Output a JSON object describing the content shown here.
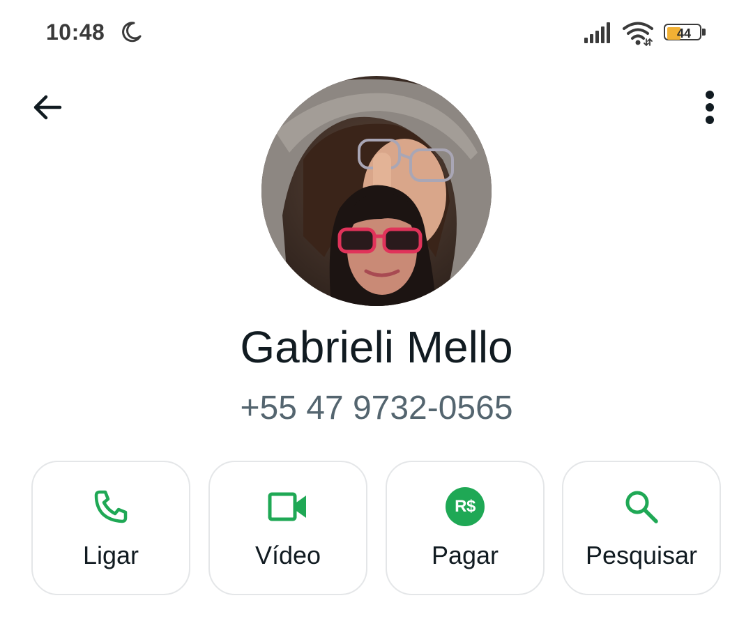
{
  "status_bar": {
    "time": "10:48",
    "battery_level": "44",
    "battery_fraction": 0.44,
    "icons": [
      "moon-icon",
      "signal-icon",
      "wifi-icon",
      "battery-icon"
    ]
  },
  "header": {
    "back_icon": "arrow-left-icon",
    "menu_icon": "more-vertical-icon"
  },
  "contact": {
    "name": "Gabrieli Mello",
    "phone": "+55 47 9732-0565"
  },
  "actions": [
    {
      "label": "Ligar",
      "icon": "phone-icon"
    },
    {
      "label": "Vídeo",
      "icon": "video-camera-icon"
    },
    {
      "label": "Pagar",
      "icon": "brl-payment-icon",
      "badge": "R$"
    },
    {
      "label": "Pesquisar",
      "icon": "search-icon"
    }
  ],
  "colors": {
    "accent": "#1fa855",
    "text_primary": "#111b21",
    "text_secondary": "#54656f",
    "card_border": "#e4e6e8",
    "battery_fill": "#f2b134"
  }
}
